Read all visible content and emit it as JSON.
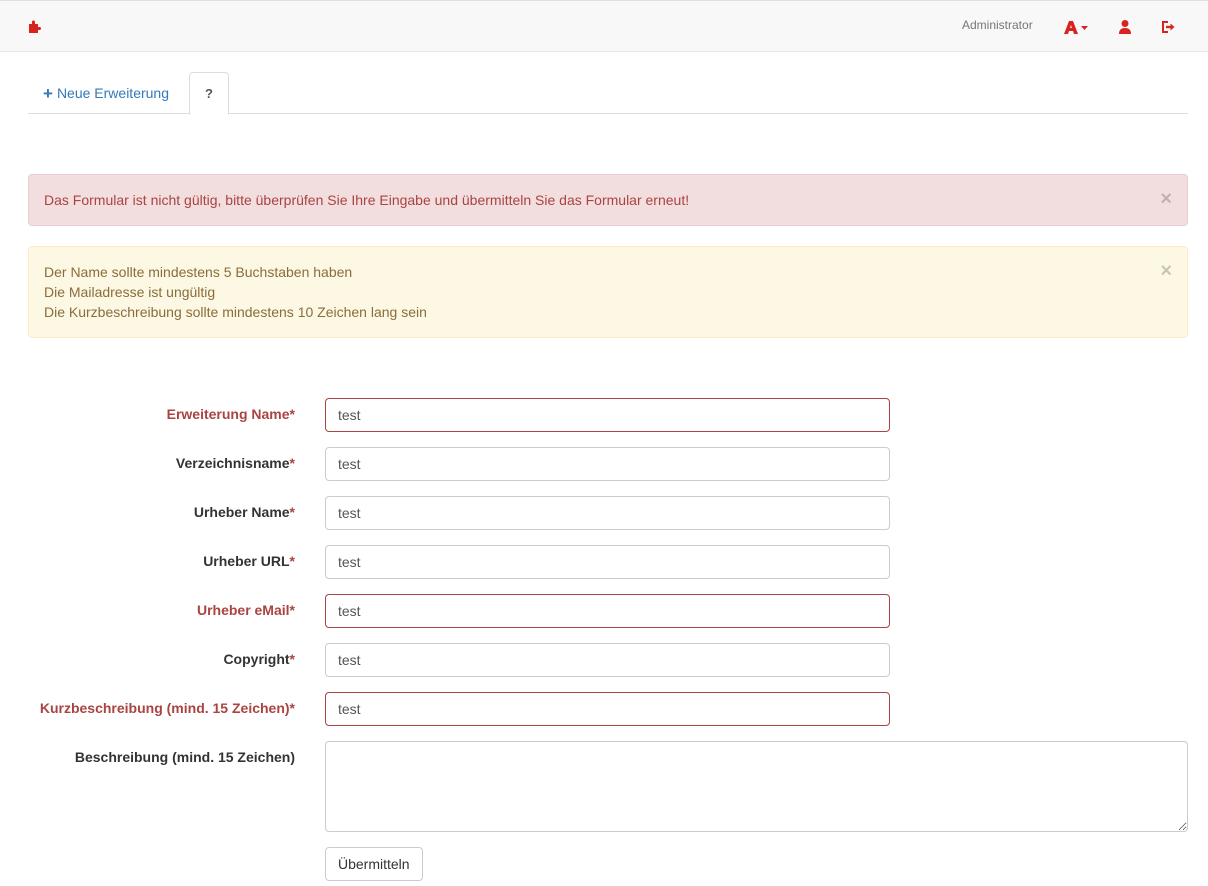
{
  "navbar": {
    "brand_icon": "puzzle-icon",
    "user_label": "Administrator",
    "icons": [
      "language-icon",
      "user-icon",
      "logout-icon"
    ],
    "accent_color": "#d9231f"
  },
  "tabs": {
    "new_label": "Neue Erweiterung",
    "help_label": "?"
  },
  "alerts": {
    "danger": {
      "text": "Das Formular ist nicht gültig, bitte überprüfen Sie Ihre Eingabe und übermitteln Sie das Formular erneut!",
      "close": "×"
    },
    "warning": {
      "lines": [
        "Der Name sollte mindestens 5 Buchstaben haben",
        "Die Mailadresse ist ungültig",
        "Die Kurzbeschreibung sollte mindestens 10 Zeichen lang sein"
      ],
      "close": "×"
    }
  },
  "form": {
    "fields": [
      {
        "label": "Erweiterung Name",
        "required": "*",
        "value": "test",
        "error": true
      },
      {
        "label": "Verzeichnisname",
        "required": "*",
        "value": "test",
        "error": false
      },
      {
        "label": "Urheber Name",
        "required": "*",
        "value": "test",
        "error": false
      },
      {
        "label": "Urheber URL",
        "required": "*",
        "value": "test",
        "error": false
      },
      {
        "label": "Urheber eMail",
        "required": "*",
        "value": "test",
        "error": true
      },
      {
        "label": "Copyright",
        "required": "*",
        "value": "test",
        "error": false
      },
      {
        "label": "Kurzbeschreibung (mind. 15 Zeichen)",
        "required": "*",
        "value": "test",
        "error": true
      }
    ],
    "description": {
      "label": "Beschreibung (mind. 15 Zeichen)",
      "value": ""
    },
    "submit_label": "Übermitteln"
  }
}
